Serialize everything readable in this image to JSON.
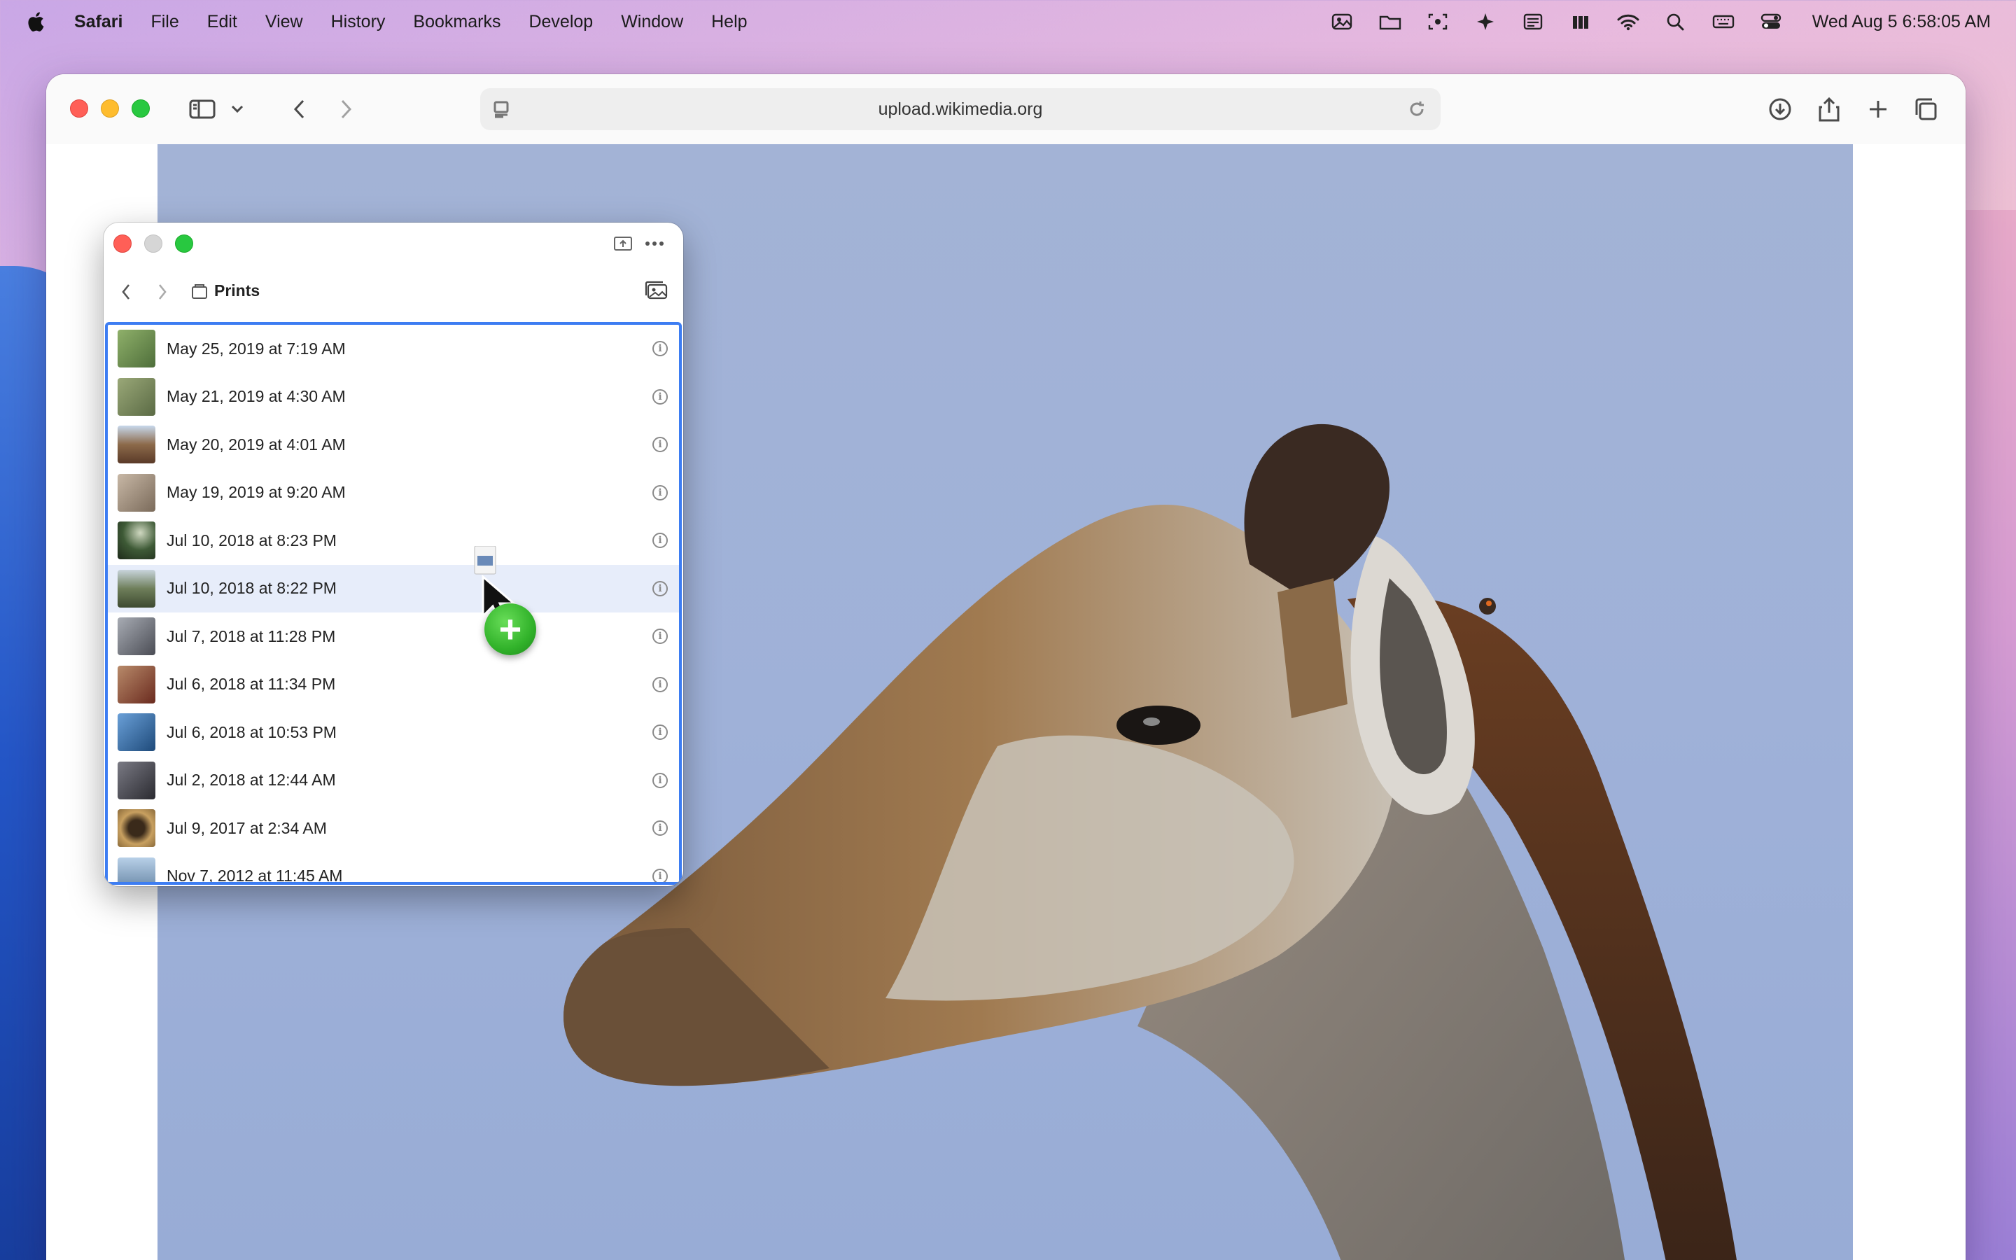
{
  "menubar": {
    "app_name": "Safari",
    "items": [
      "File",
      "Edit",
      "View",
      "History",
      "Bookmarks",
      "Develop",
      "Window",
      "Help"
    ],
    "clock": "Wed Aug 5  6:58:05 AM",
    "status_icons": [
      "photos-icon",
      "folder-icon",
      "screenshot-icon",
      "sparkle-icon",
      "news-icon",
      "controller-icon",
      "wifi-icon",
      "search-icon",
      "keyboard-icon",
      "control-center-icon"
    ]
  },
  "safari": {
    "address": "upload.wikimedia.org",
    "toolbar_icons": [
      "sidebar-icon",
      "chevron-down-icon",
      "back-icon",
      "forward-icon",
      "icloud-icon",
      "tab-icon",
      "reader-icon",
      "reload-icon",
      "download-icon",
      "share-icon",
      "new-tab-icon",
      "tabs-overview-icon"
    ]
  },
  "picker": {
    "title": "Prints",
    "rows": [
      {
        "label": "May 25, 2019 at 7:19 AM",
        "thumb": "#6b8f4e"
      },
      {
        "label": "May 21, 2019 at 4:30 AM",
        "thumb": "#7a8b5a"
      },
      {
        "label": "May 20, 2019 at 4:01 AM",
        "thumb": "#8c6a4a"
      },
      {
        "label": "May 19, 2019 at 9:20 AM",
        "thumb": "#9a8a7a"
      },
      {
        "label": "Jul 10, 2018 at 8:23 PM",
        "thumb": "#3e5a36"
      },
      {
        "label": "Jul 10, 2018 at 8:22 PM",
        "thumb": "#5e6e4a"
      },
      {
        "label": "Jul 7, 2018 at 11:28 PM",
        "thumb": "#6a6c74"
      },
      {
        "label": "Jul 6, 2018 at 11:34 PM",
        "thumb": "#7a4a3a"
      },
      {
        "label": "Jul 6, 2018 at 10:53 PM",
        "thumb": "#2e5a8a"
      },
      {
        "label": "Jul 2, 2018 at 12:44 AM",
        "thumb": "#4a4a54"
      },
      {
        "label": "Jul 9, 2017 at 2:34 AM",
        "thumb": "#8a6a3a"
      },
      {
        "label": "Nov 7, 2012 at 11:45 AM",
        "thumb": "#7aa0c8"
      }
    ],
    "selected_index": 5
  },
  "drag": {
    "badge": "+"
  }
}
